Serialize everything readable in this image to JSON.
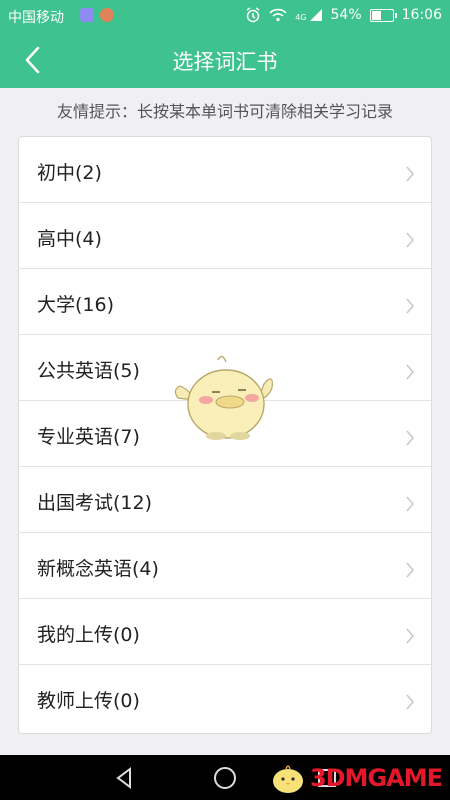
{
  "status_bar": {
    "carrier": "中国移动",
    "network": "4G",
    "battery_percent": "54%",
    "battery_level": 0.54,
    "time": "16:06"
  },
  "header": {
    "title": "选择词汇书",
    "back_icon": "chevron-left-icon"
  },
  "hint": "友情提示：长按某本单词书可清除相关学习记录",
  "books": [
    {
      "label": "初中(2)"
    },
    {
      "label": "高中(4)"
    },
    {
      "label": "大学(16)"
    },
    {
      "label": "公共英语(5)"
    },
    {
      "label": "专业英语(7)"
    },
    {
      "label": "出国考试(12)"
    },
    {
      "label": "新概念英语(4)"
    },
    {
      "label": "我的上传(0)"
    },
    {
      "label": "教师上传(0)"
    }
  ],
  "nav": {
    "back_icon": "triangle-back-icon",
    "home_icon": "circle-home-icon",
    "recents_icon": "square-recents-icon"
  },
  "watermark": {
    "text": "3DMGAME",
    "color": "#e5172a"
  },
  "colors": {
    "primary": "#3ec28f",
    "background": "#efeff4"
  }
}
